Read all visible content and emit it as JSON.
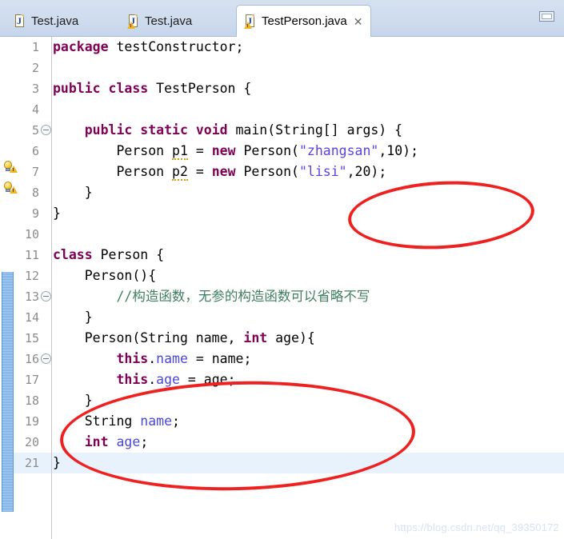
{
  "window": {
    "minimize_label": "Minimize"
  },
  "tabs": [
    {
      "label": "Test.java",
      "icon": "java-file-icon",
      "has_warning": false,
      "active": false,
      "closable": false
    },
    {
      "label": "Test.java",
      "icon": "java-file-warning-icon",
      "has_warning": true,
      "active": false,
      "closable": false
    },
    {
      "label": "TestPerson.java",
      "icon": "java-file-warning-icon",
      "has_warning": true,
      "active": true,
      "closable": true,
      "close_glyph": "✕"
    }
  ],
  "editor": {
    "current_line": 21,
    "change_bar_range": [
      11,
      21
    ],
    "lines": [
      {
        "n": 1,
        "fold": false,
        "marker": null,
        "text": "package testConstructor;"
      },
      {
        "n": 2,
        "fold": false,
        "marker": null,
        "text": ""
      },
      {
        "n": 3,
        "fold": false,
        "marker": null,
        "text": "public class TestPerson {"
      },
      {
        "n": 4,
        "fold": false,
        "marker": null,
        "text": ""
      },
      {
        "n": 5,
        "fold": true,
        "marker": null,
        "text": "    public static void main(String[] args) {"
      },
      {
        "n": 6,
        "fold": false,
        "marker": "quickfix-warning-icon",
        "text": "        Person p1 = new Person(\"zhangsan\",10);"
      },
      {
        "n": 7,
        "fold": false,
        "marker": "quickfix-warning-icon",
        "text": "        Person p2 = new Person(\"lisi\",20);"
      },
      {
        "n": 8,
        "fold": false,
        "marker": null,
        "text": "    }"
      },
      {
        "n": 9,
        "fold": false,
        "marker": null,
        "text": "}"
      },
      {
        "n": 10,
        "fold": false,
        "marker": null,
        "text": ""
      },
      {
        "n": 11,
        "fold": false,
        "marker": null,
        "text": "class Person {"
      },
      {
        "n": 12,
        "fold": true,
        "marker": null,
        "text": "    Person(){"
      },
      {
        "n": 13,
        "fold": false,
        "marker": null,
        "text": "        //构造函数，无参的构造函数可以省略不写"
      },
      {
        "n": 14,
        "fold": false,
        "marker": null,
        "text": "    }"
      },
      {
        "n": 15,
        "fold": true,
        "marker": null,
        "text": "    Person(String name, int age){"
      },
      {
        "n": 16,
        "fold": false,
        "marker": null,
        "text": "        this.name = name;"
      },
      {
        "n": 17,
        "fold": false,
        "marker": null,
        "text": "        this.age = age;"
      },
      {
        "n": 18,
        "fold": false,
        "marker": null,
        "text": "    }"
      },
      {
        "n": 19,
        "fold": false,
        "marker": null,
        "text": "    String name;"
      },
      {
        "n": 20,
        "fold": false,
        "marker": null,
        "text": "    int age;"
      },
      {
        "n": 21,
        "fold": false,
        "marker": null,
        "text": "}"
      }
    ],
    "line_numbers": [
      "1",
      "2",
      "3",
      "4",
      "5",
      "6",
      "7",
      "8",
      "9",
      "10",
      "11",
      "12",
      "13",
      "14",
      "15",
      "16",
      "17",
      "18",
      "19",
      "20",
      "21"
    ]
  },
  "annotations": [
    {
      "name": "red-ellipse-constructor-calls",
      "shape": "ellipse",
      "color": "#ee2020"
    },
    {
      "name": "red-ellipse-parameterized-constructor",
      "shape": "ellipse",
      "color": "#ee2020"
    }
  ],
  "watermark": {
    "text": "https://blog.csdn.net/qq_39350172"
  },
  "colors": {
    "keyword": "#7f0055",
    "string": "#5c41e0",
    "comment": "#3f7f5f",
    "field": "#4a48d8",
    "annotation_red": "#ee2020",
    "change_bar_blue": "#7aaee8",
    "current_line": "#e8f2fd",
    "tab_bar": "#cfdcee"
  }
}
